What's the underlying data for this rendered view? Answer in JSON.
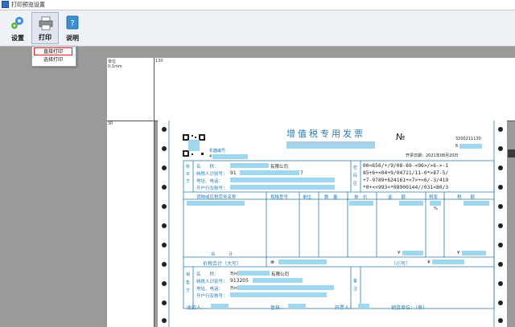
{
  "window": {
    "title": "打印预览设置"
  },
  "toolbar": {
    "settings_label": "设置",
    "print_label": "打印",
    "help_label": "说明"
  },
  "print_menu": {
    "direct_print": "直接打印",
    "choose_print": "选择打印"
  },
  "ruler": {
    "unit_label": "单位",
    "unit_value": "0.1mm",
    "horizontal_value": "130",
    "vertical_value": "30"
  },
  "invoice": {
    "title": "增值税专用发票",
    "no_symbol": "№",
    "invoice_code": "3200211130",
    "invoice_number_prefix": "6",
    "issue_date": "开票日期：2021年08月20日",
    "machine_no_label": "机器编号：",
    "machine_no_value": "4",
    "buyer_side_label": "购买方",
    "seller_side_label": "销售方",
    "buyer": {
      "name_label": "名　　称：",
      "name_suffix": "有限公司",
      "taxid_label": "纳税人识别号：",
      "taxid_prefix": "91",
      "taxid_suffix": "7",
      "addr_label": "地址、电话：",
      "bank_label": "开户行及账号："
    },
    "password_area_label": "密码区",
    "password_lines": [
      "00<656/+/9/08-69-<96>/>6->-1",
      "85+6+<04+9/04721/11-0*>87-5/",
      "+7-9789+624161+<7>+<6/-3/419",
      "*0+<<993<*08900144//031<80/3"
    ],
    "columns": {
      "goods": "货物或应税劳务名称",
      "spec": "规格型号",
      "unit": "单位",
      "qty": "数　量",
      "price": "单　价",
      "amount": "金　　额",
      "rate": "税率",
      "tax": "税　　额"
    },
    "rate_value": "%",
    "subtotal_label": "合　　　计",
    "yen": "¥",
    "total_label": "价税合计（大写）",
    "total_circle": "⊗",
    "small_label": "（小写）",
    "seller": {
      "name_label": "名　　称：",
      "name_prefix": "苏州",
      "name_suffix": "有限公司",
      "taxid_label": "纳税人识别号：",
      "taxid_prefix": "913205",
      "addr_label": "地址、电话：",
      "addr_prefix": "苏州",
      "bank_label": "开户行及账号："
    },
    "remarks_label": "备注",
    "footer": {
      "payee": "收款人：",
      "reviewer": "复核：",
      "issuer": "开票人：",
      "seller_unit": "销货单位：（章）"
    }
  },
  "colors": {
    "invoice_line": "#2a7db0",
    "mask": "#9fd8ee",
    "menu_highlight": "#d62020"
  }
}
